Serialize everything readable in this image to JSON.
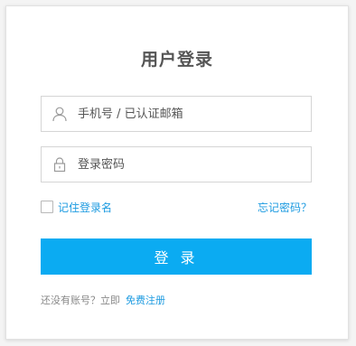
{
  "form": {
    "title": "用户登录",
    "username": {
      "placeholder": "手机号 / 已认证邮箱",
      "value": "",
      "icon": "user-icon"
    },
    "password": {
      "placeholder": "登录密码",
      "value": "",
      "icon": "lock-icon"
    },
    "remember_label": "记住登录名",
    "remember_checked": false,
    "forgot_label": "忘记密码？",
    "submit_label": "登 录",
    "register_prompt": "还没有账号？立即",
    "register_link": "免费注册"
  },
  "colors": {
    "accent": "#0babf2",
    "link": "#1b9ae0",
    "title": "#555555"
  }
}
